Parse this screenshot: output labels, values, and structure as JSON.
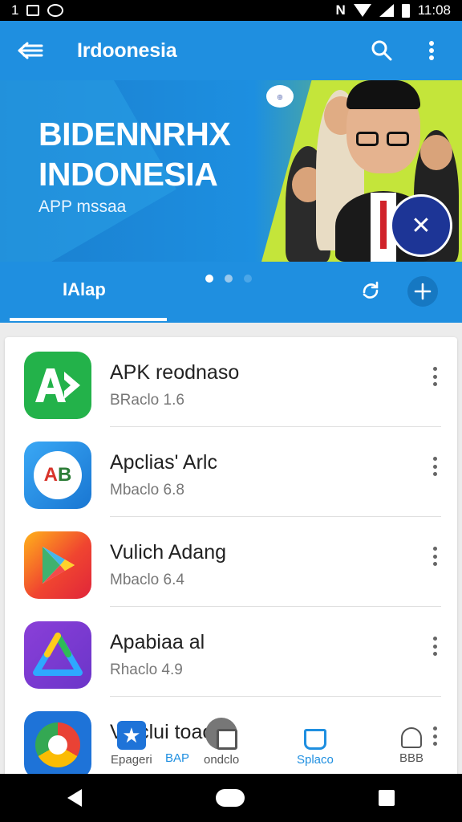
{
  "status_bar": {
    "left_text": "1",
    "time": "11:08",
    "icons": [
      "gallery-icon",
      "camera-icon",
      "nfc-icon",
      "wifi-icon",
      "signal-icon",
      "battery-icon"
    ]
  },
  "app_bar": {
    "title": "Irdoonesia",
    "icons": [
      "back-arrow-icon",
      "search-icon",
      "overflow-menu-icon"
    ]
  },
  "banner": {
    "headline_line1": "BIDENNRHX",
    "headline_line2": "INDONESIA",
    "subtitle": "APP mssaa",
    "pager_dots": 3,
    "active_dot": 0
  },
  "tabs": {
    "active_label": "IAlap",
    "icons": [
      "refresh-icon",
      "add-icon"
    ]
  },
  "apps": [
    {
      "name": "APK reodnaso",
      "meta": "BRaclo 1.6",
      "icon_text": "A",
      "icon_color": "#23b24a"
    },
    {
      "name": "Apclias' Arlc",
      "meta": "Mbaclo 6.8",
      "icon_text": "AB",
      "icon_color": "#2196f3"
    },
    {
      "name": "Vulich Adang",
      "meta": "Mbaclo 6.4",
      "icon_text": "",
      "icon_color": "#f15a24"
    },
    {
      "name": "Apabiaa al",
      "meta": "Rhaclo 4.9",
      "icon_text": "",
      "icon_color": "#7b3fd3"
    },
    {
      "name": "Vlaclui toaoid",
      "meta": "",
      "icon_text": "",
      "icon_color": "#1e73d8"
    }
  ],
  "bottom_nav": [
    {
      "label": "Epageri",
      "accent": "",
      "icon": "star-icon"
    },
    {
      "label": "BAP",
      "accent": "#1f8fe0",
      "icon": ""
    },
    {
      "label": "ondclo",
      "accent": "",
      "icon": "download-icon"
    },
    {
      "label": "Splaco",
      "accent": "#1f8fe0",
      "icon": "shopping-bag-icon"
    },
    {
      "label": "BBB",
      "accent": "",
      "icon": "bell-icon"
    }
  ],
  "colors": {
    "primary": "#1f8fe0",
    "banner_accent": "#a6d62e"
  }
}
